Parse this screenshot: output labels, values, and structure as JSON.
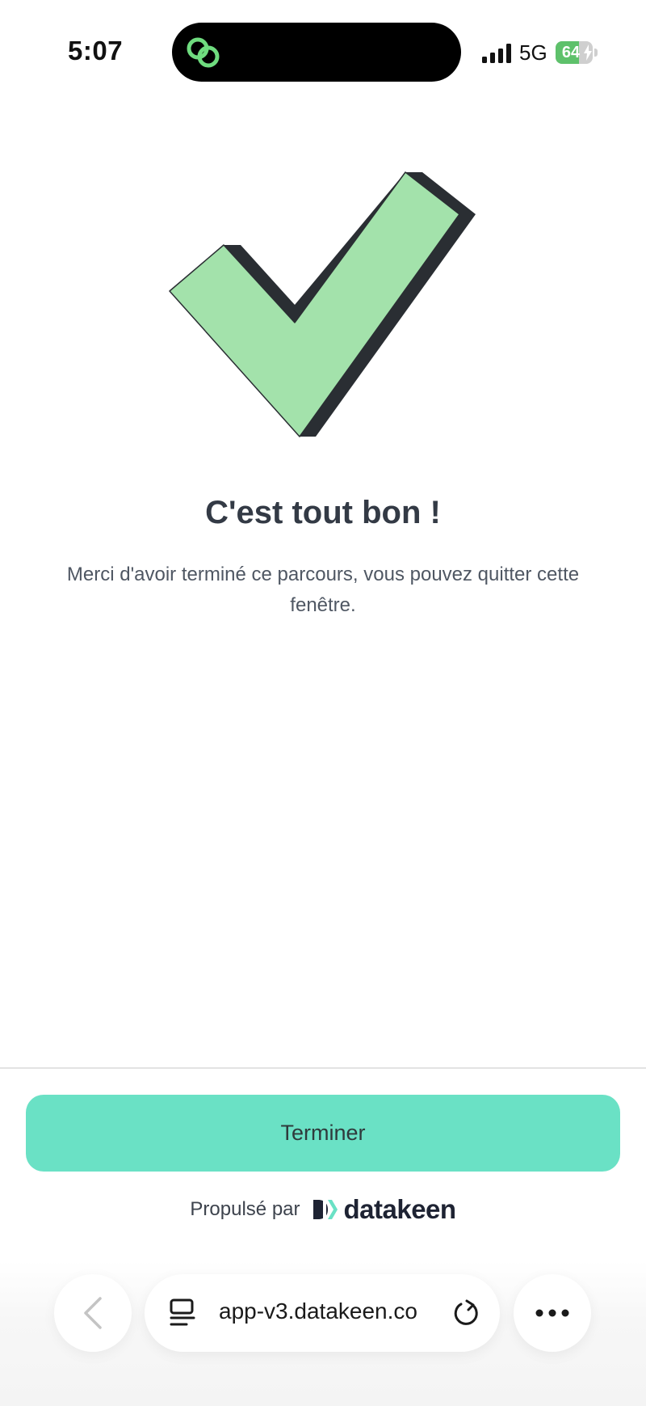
{
  "status_bar": {
    "time": "5:07",
    "network": "5G",
    "battery_percent": 64,
    "battery_label": "64",
    "charging": true,
    "icons": {
      "island": "linked-rings-icon",
      "signal": "signal-bars-icon",
      "battery": "battery-icon",
      "bolt": "charging-bolt-icon"
    }
  },
  "illustration": {
    "icon": "checkmark-icon",
    "fill_color": "#a3e2ab",
    "shadow_color": "#2a2e33"
  },
  "content": {
    "title": "C'est tout bon !",
    "message": "Merci d'avoir terminé ce parcours, vous pouvez quitter cette fenêtre."
  },
  "footer": {
    "finish_label": "Terminer",
    "powered_by_label": "Propulsé par",
    "brand_name": "datakeen",
    "brand_icon": "datakeen-logo-icon",
    "button_color": "#6ae1c5"
  },
  "browser": {
    "url": "app-v3.datakeen.co",
    "icons": {
      "back": "chevron-left-icon",
      "reader": "reader-mode-icon",
      "reload": "reload-icon",
      "more": "more-dots-icon"
    }
  },
  "colors": {
    "title": "#333a45",
    "text": "#4f5763",
    "island_accent": "#6fdc7f"
  }
}
